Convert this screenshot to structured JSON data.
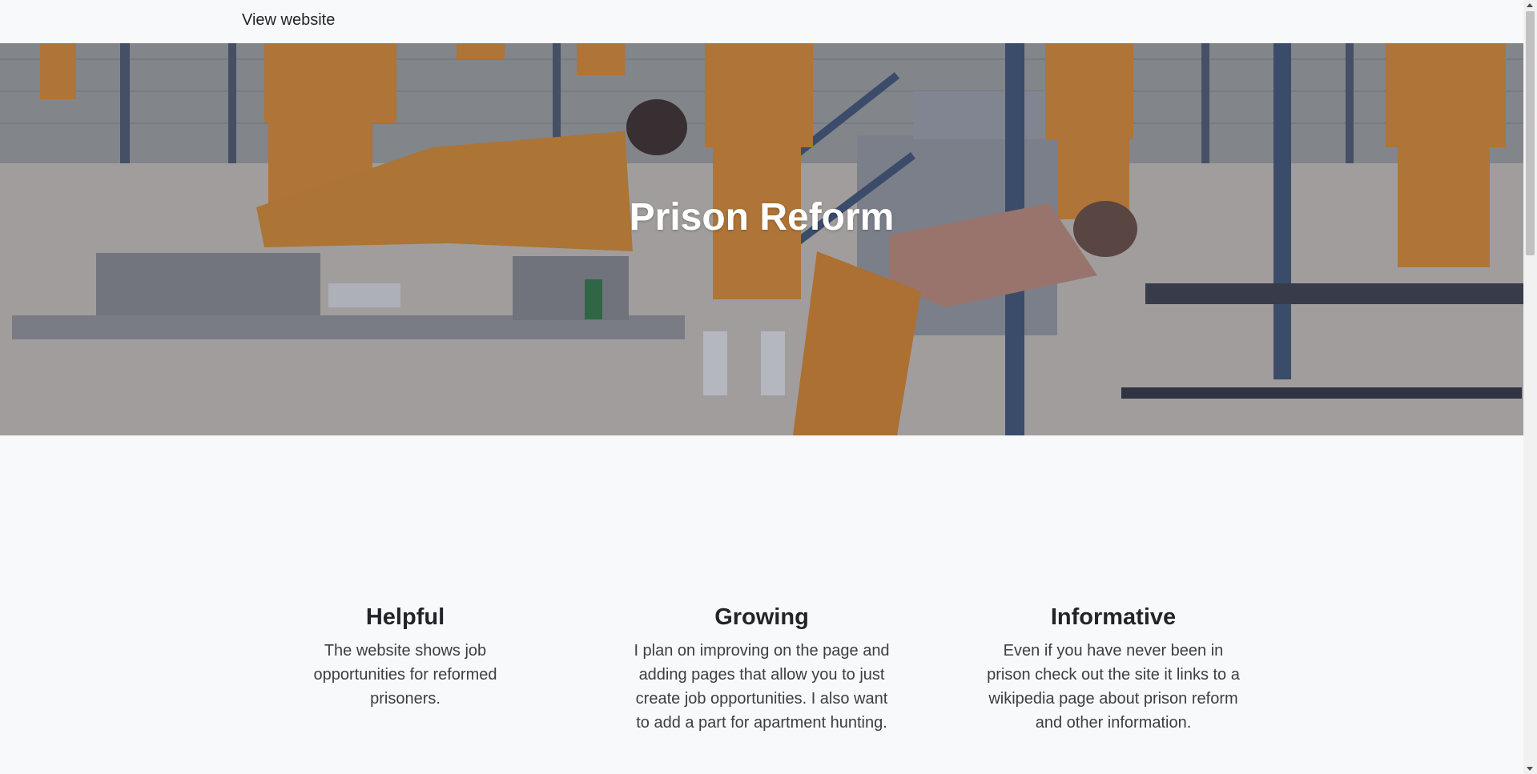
{
  "navbar": {
    "brand_label": "View website"
  },
  "hero": {
    "title": "Prison Reform",
    "image_description_icon": "photo-icon"
  },
  "features": [
    {
      "title": "Helpful",
      "text": "The website shows job opportunities for reformed prisoners."
    },
    {
      "title": "Growing",
      "text": "I plan on improving on the page and adding pages that allow you to just create job opportunities. I also want to add a part for apartment hunting."
    },
    {
      "title": "Informative",
      "text": "Even if you have never been in prison check out the site it links to a wikipedia page about prison reform and other information."
    }
  ],
  "colors": {
    "background": "#f8f9fa",
    "text": "#212529",
    "hero_title": "#ffffff"
  }
}
